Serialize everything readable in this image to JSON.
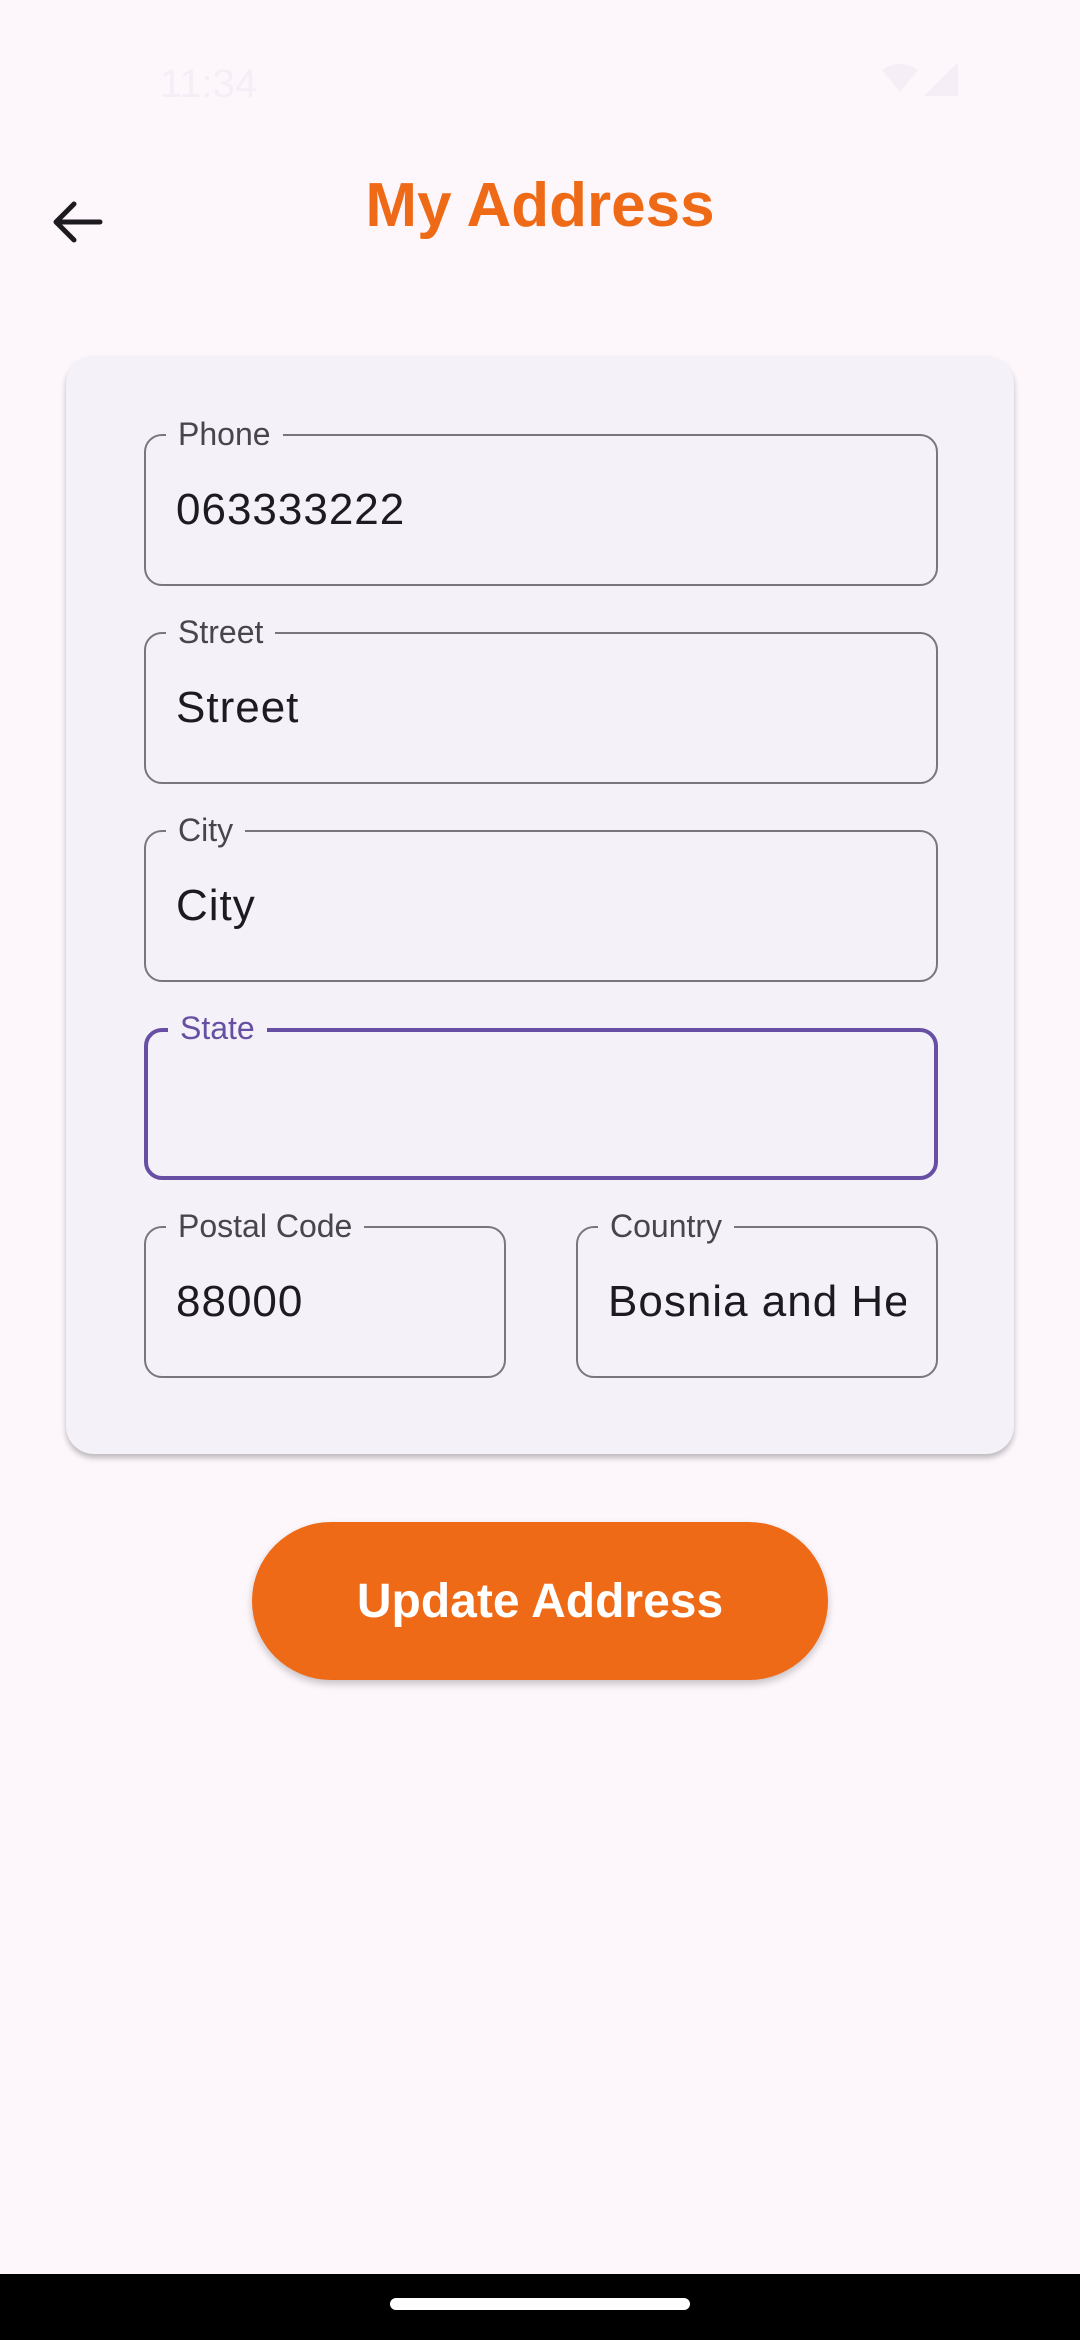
{
  "status_bar": {
    "time": "11:34",
    "icons": [
      "wifi-icon",
      "signal-icon"
    ]
  },
  "header": {
    "title": "My Address",
    "back_icon": "arrow-left-icon",
    "title_color": "#ee6a16"
  },
  "form": {
    "phone": {
      "label": "Phone",
      "value": "063333222"
    },
    "street": {
      "label": "Street",
      "value": "Street"
    },
    "city": {
      "label": "City",
      "value": "City"
    },
    "state": {
      "label": "State",
      "value": ""
    },
    "postal_code": {
      "label": "Postal Code",
      "value": "88000"
    },
    "country": {
      "label": "Country",
      "value": "Bosnia and Herzegovina"
    }
  },
  "update_button": {
    "label": "Update Address",
    "color": "#ee6a16"
  },
  "colors": {
    "accent": "#ee6a16",
    "focus": "#6750a4",
    "background": "#fdf7fc",
    "card": "#f4f2f8"
  }
}
